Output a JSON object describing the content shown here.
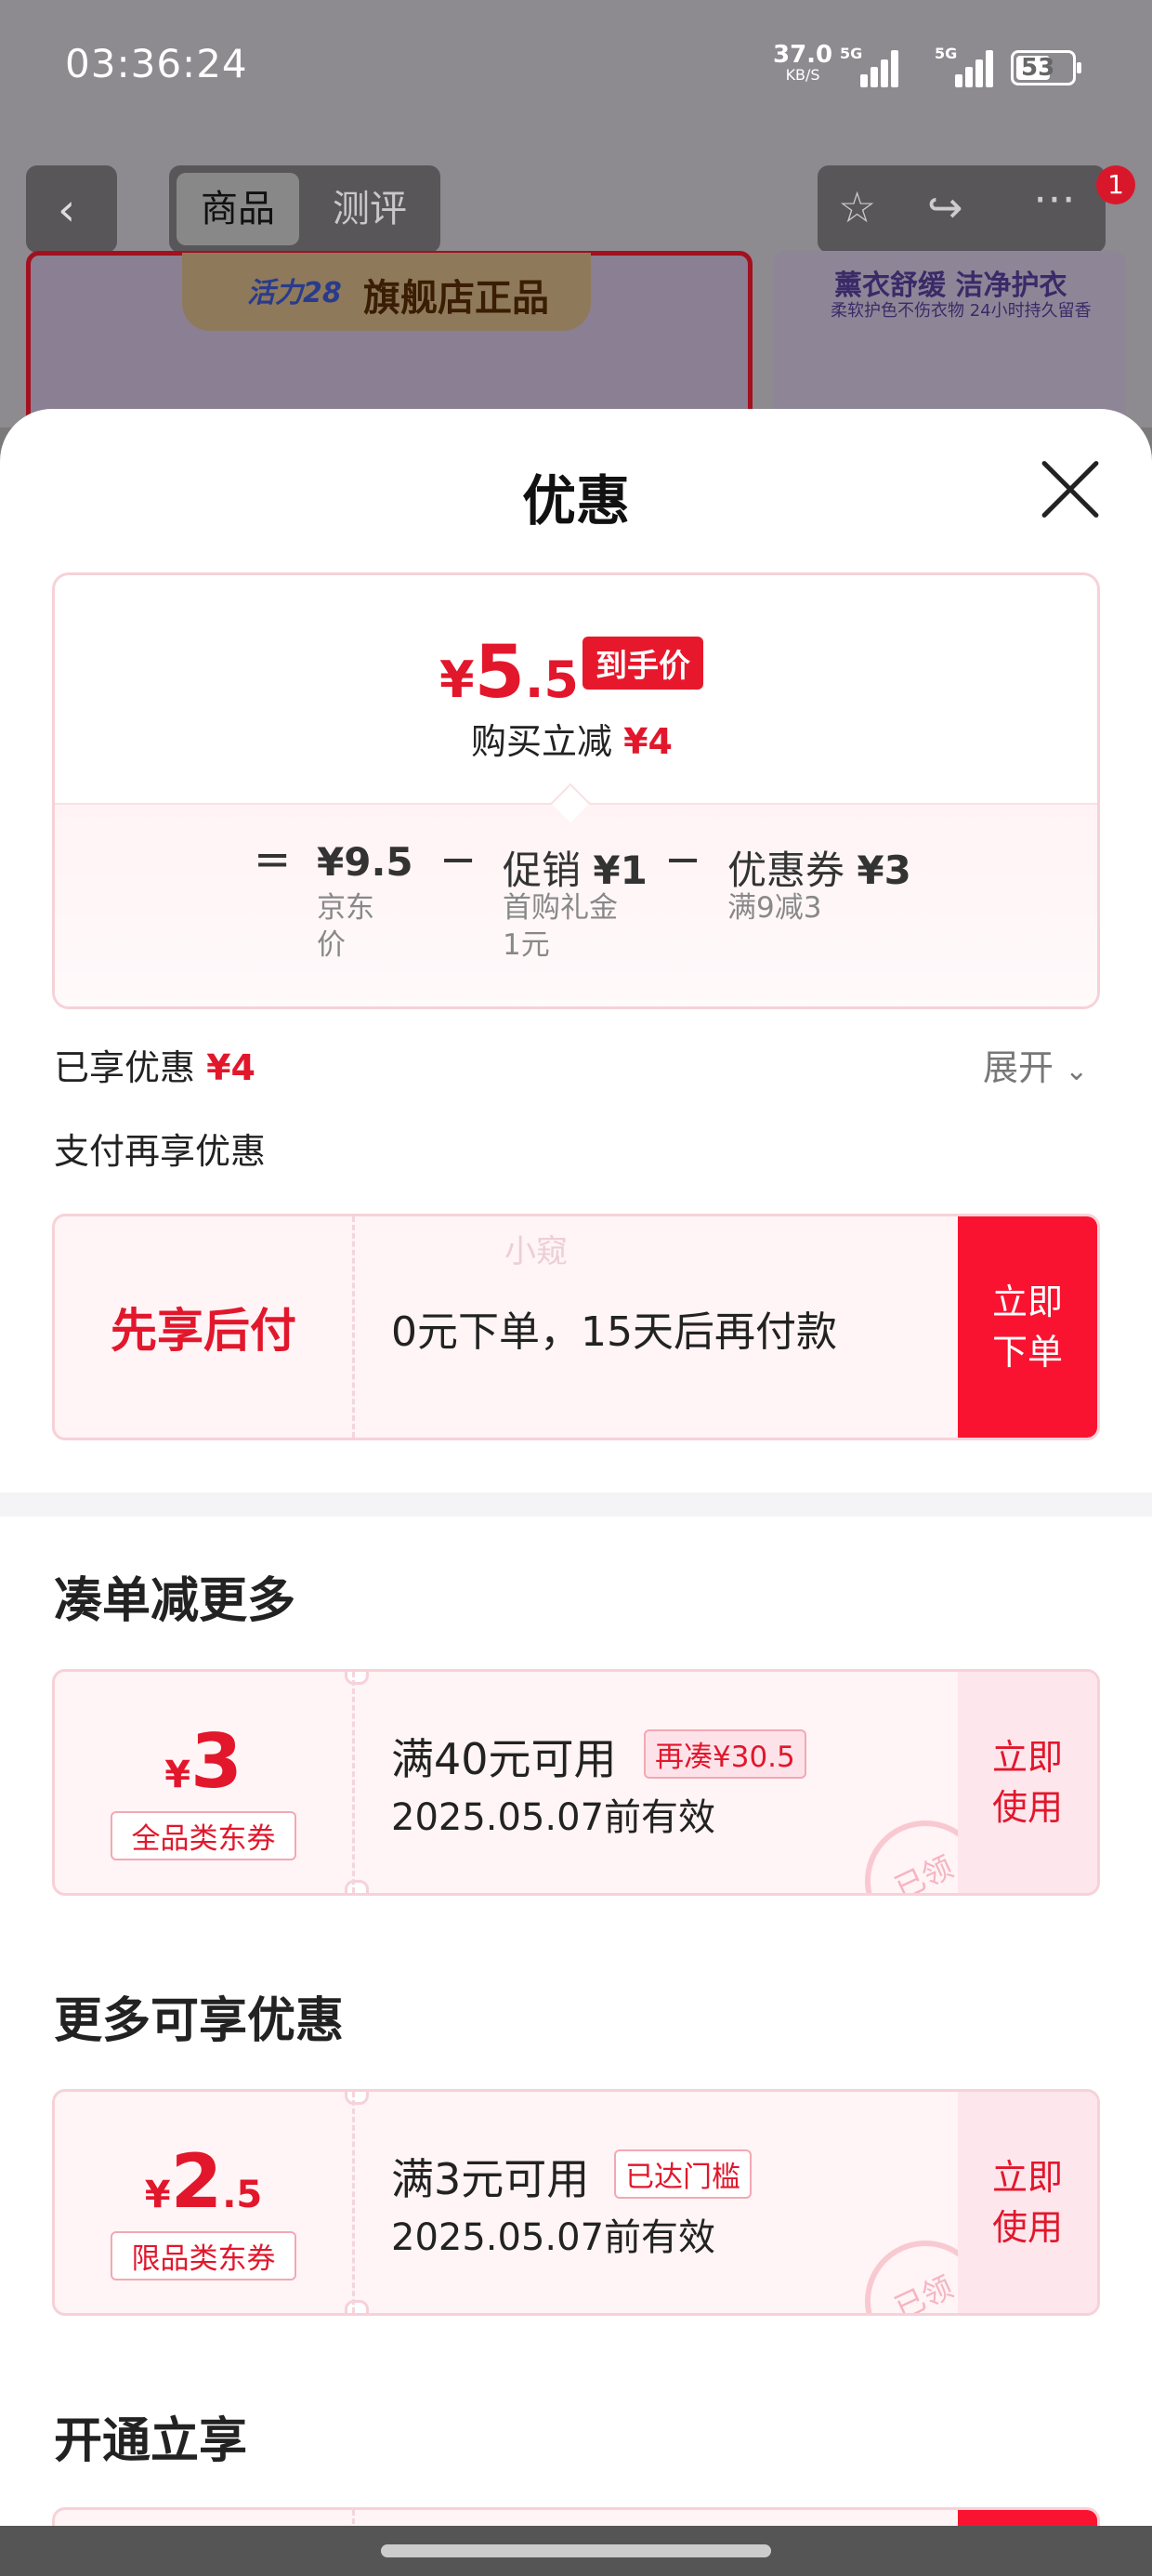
{
  "status_bar": {
    "time": "03:36:24",
    "net_speed": "37.0",
    "net_unit": "KB/S",
    "sig1_label": "5G",
    "sig2_label": "5G",
    "battery": "53"
  },
  "nav": {
    "tab_active": "商品",
    "tab_inactive": "测评",
    "cart_badge": "1"
  },
  "product": {
    "brand_logo": "活力28",
    "banner": "旗舰店正品",
    "p2_title": "薰衣舒缓 洁净护衣",
    "p2_sub": "柔软护色不伤衣物 24小时持久留香"
  },
  "sheet": {
    "title": "优惠",
    "final_price": {
      "currency": "¥",
      "integer": "5",
      "decimal": ".5",
      "tag": "到手价"
    },
    "reduce": {
      "label": "购买立减",
      "amount": "¥4"
    },
    "formula": {
      "eq": "=",
      "minus1": "−",
      "minus2": "−",
      "jd_amount": "¥9.5",
      "jd_sub1": "京东",
      "jd_sub2": "价",
      "promo_label": "促销",
      "promo_amount": "¥1",
      "promo_sub1": "首购礼金",
      "promo_sub2": "1元",
      "coupon_label": "优惠券",
      "coupon_amount": "¥3",
      "coupon_sub": "满9减3"
    },
    "enjoyed": {
      "label": "已享优惠",
      "amount": "¥4"
    },
    "expand": "展开",
    "pay_hint": "支付再享优惠",
    "pay_later": {
      "title": "先享后付",
      "desc": "0元下单，15天后再付款",
      "watermark": "小窥",
      "cta": "立即下单"
    },
    "section1": "凑单减更多",
    "coupon1": {
      "currency": "¥",
      "integer": "3",
      "decimal": "",
      "type": "全品类东券",
      "condition": "满40元可用",
      "tag": "再凑¥30.5",
      "expiry": "2025.05.07前有效",
      "stamp": "已领",
      "cta": "立即使用"
    },
    "section2": "更多可享优惠",
    "coupon2": {
      "currency": "¥",
      "integer": "2",
      "decimal": ".5",
      "type": "限品类东券",
      "condition": "满3元可用",
      "tag": "已达门槛",
      "expiry": "2025.05.07前有效",
      "stamp": "已领",
      "cta": "立即使用"
    },
    "section3": "开通立享"
  },
  "colors": {
    "accent_red": "#e2172c",
    "cta_red": "#fa1330",
    "card_bg": "#fff4f6"
  }
}
